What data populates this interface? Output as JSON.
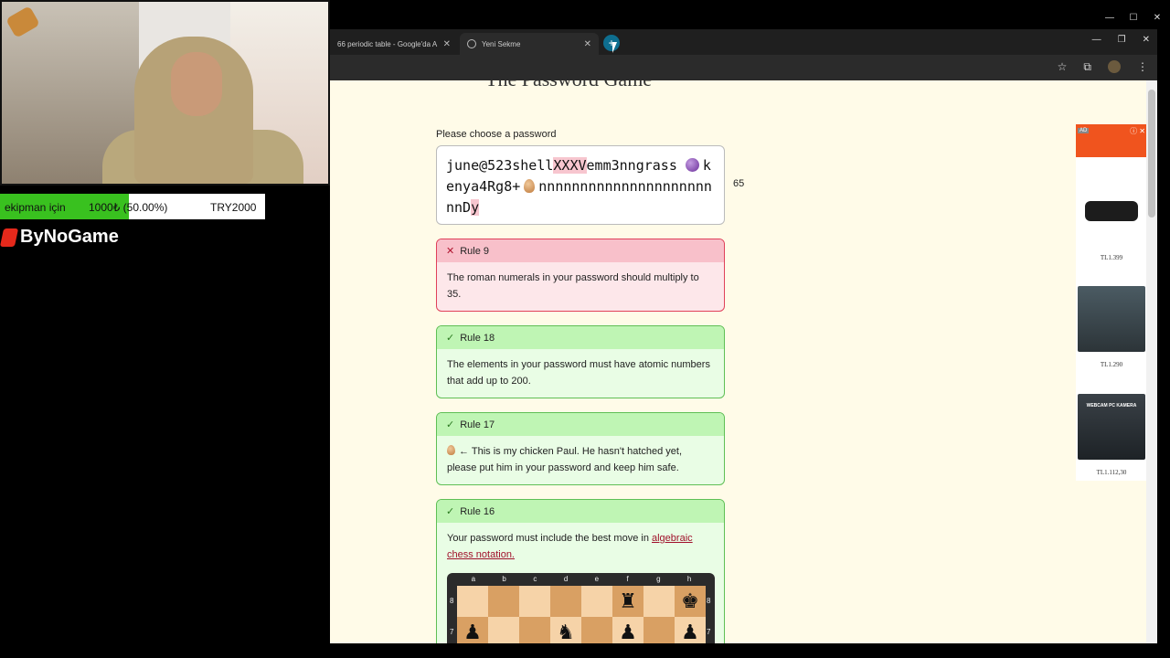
{
  "browser": {
    "tabs": [
      {
        "title": "66 periodic table - Google'da A"
      },
      {
        "title": "Yeni Sekme"
      }
    ],
    "new_tab": "+"
  },
  "page": {
    "title": "The Password Game",
    "password_label": "Please choose a password",
    "password": {
      "part1": "june@523shell",
      "part_hl": "XXXV",
      "part2": "emm3nngrass",
      "part3": "kenya4Rg8+",
      "part4": "nnnnnnnnnnnnnnnnnnnnnnnD",
      "part_hl2": "y"
    },
    "char_count": "65",
    "rules": [
      {
        "title": "Rule 9",
        "status": "fail",
        "text": "The roman numerals in your password should multiply to 35."
      },
      {
        "title": "Rule 18",
        "status": "ok",
        "text": "The elements in your password must have atomic numbers that add up to 200."
      },
      {
        "title": "Rule 17",
        "status": "ok",
        "text": "← This is my chicken Paul. He hasn't hatched yet, please put him in your password and keep him safe."
      },
      {
        "title": "Rule 16",
        "status": "ok",
        "text": "Your password must include the best move in ",
        "link": "algebraic chess notation."
      }
    ],
    "chess": {
      "files": [
        "a",
        "b",
        "c",
        "d",
        "e",
        "f",
        "g",
        "h"
      ],
      "ranks": [
        "8",
        "7"
      ]
    }
  },
  "ads": {
    "badge": "AD",
    "prices": [
      "TL1.399",
      "TL1.290",
      "TL1.112,30"
    ],
    "kamera_text": "WEBCAM PC KAMERA"
  },
  "overlay": {
    "donation_label": "ekipman için",
    "donation_amount": "1000₺ (50.00%)",
    "donation_code": "TRY2000",
    "donation_progress": 0.5,
    "brand": "ByNoGame"
  }
}
